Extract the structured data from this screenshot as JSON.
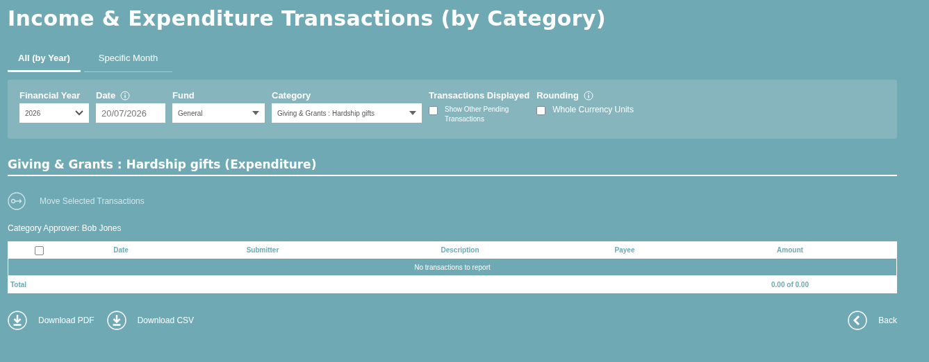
{
  "title": "Income & Expenditure Transactions (by Category)",
  "tabs": [
    {
      "label": "All (by Year)",
      "selected": true
    },
    {
      "label": "Specific Month",
      "selected": false
    }
  ],
  "filters": {
    "financial_year": {
      "label": "Financial Year",
      "value": "2026"
    },
    "date": {
      "label": "Date",
      "value": "20/07/2026"
    },
    "fund": {
      "label": "Fund",
      "value": "General"
    },
    "category": {
      "label": "Category",
      "value": "Giving & Grants : Hardship gifts"
    },
    "transactions_displayed": {
      "label": "Transactions Displayed",
      "option": "Show Other Pending Transactions",
      "checked": false
    },
    "rounding": {
      "label": "Rounding",
      "option": "Whole Currency Units",
      "checked": false
    }
  },
  "section_title": "Giving & Grants : Hardship gifts (Expenditure)",
  "move_button": {
    "label": "Move Selected Transactions",
    "disabled": true
  },
  "approver": "Category Approver: Bob Jones",
  "table": {
    "select_all_checked": false,
    "columns": [
      "Date",
      "Submitter",
      "Description",
      "Payee",
      "Amount"
    ],
    "empty_message": "No transactions to report",
    "total_label": "Total",
    "total_amount": "0.00 of 0.00"
  },
  "downloads": [
    "Download PDF",
    "Download CSV"
  ],
  "back": "Back"
}
